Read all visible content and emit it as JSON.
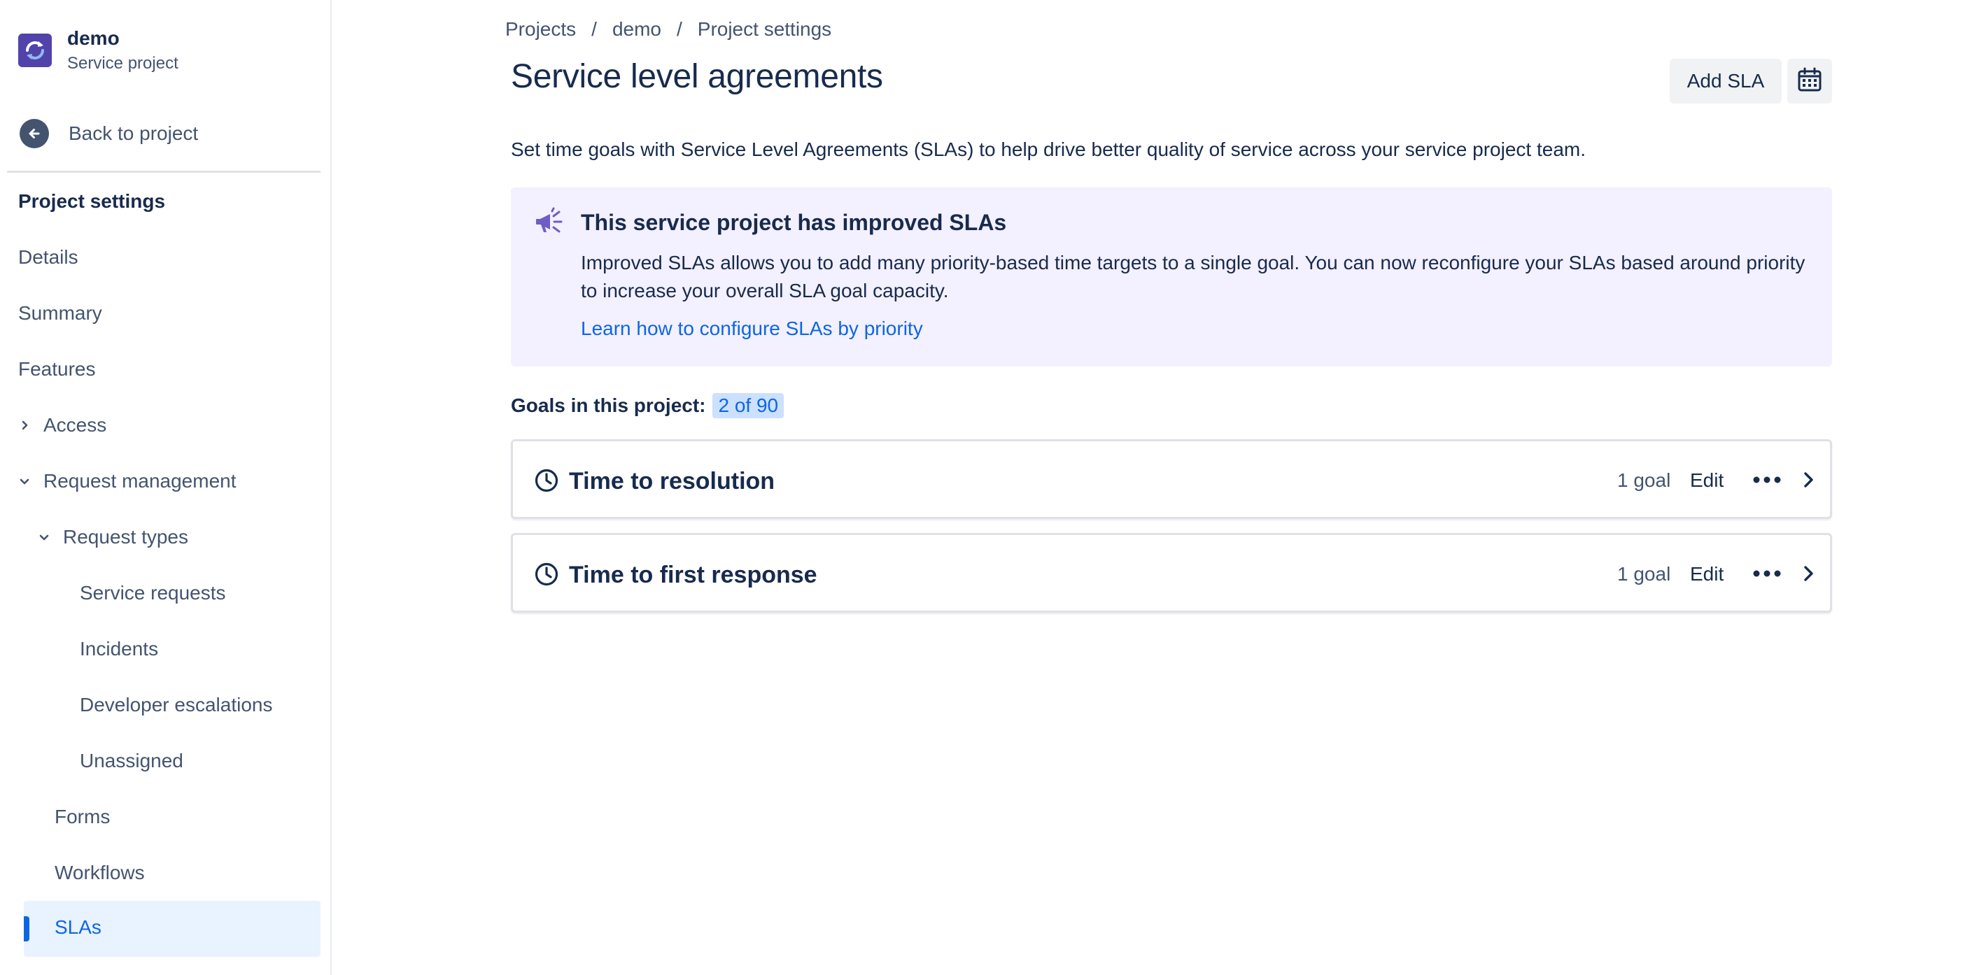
{
  "project": {
    "name": "demo",
    "type": "Service project"
  },
  "sidebar": {
    "back_label": "Back to project",
    "heading": "Project settings",
    "items": [
      {
        "label": "Details"
      },
      {
        "label": "Summary"
      },
      {
        "label": "Features"
      },
      {
        "label": "Access",
        "expandable": true,
        "expanded": false
      },
      {
        "label": "Request management",
        "expandable": true,
        "expanded": true
      },
      {
        "label": "Request types",
        "expandable": true,
        "expanded": true
      },
      {
        "label": "Service requests"
      },
      {
        "label": "Incidents"
      },
      {
        "label": "Developer escalations"
      },
      {
        "label": "Unassigned"
      },
      {
        "label": "Forms"
      },
      {
        "label": "Workflows"
      },
      {
        "label": "SLAs",
        "active": true
      }
    ]
  },
  "breadcrumb": [
    "Projects",
    "demo",
    "Project settings"
  ],
  "breadcrumb_separator": "/",
  "page": {
    "title": "Service level agreements",
    "add_button": "Add SLA",
    "calendar_icon": "calendar-icon",
    "intro": "Set time goals with Service Level Agreements (SLAs) to help drive better quality of service across your service project team."
  },
  "banner": {
    "icon": "megaphone-icon",
    "title": "This service project has improved SLAs",
    "body": "Improved SLAs allows you to add many priority-based time targets to a single goal. You can now reconfigure your SLAs based around priority to increase your overall SLA goal capacity.",
    "link": "Learn how to configure SLAs by priority"
  },
  "goals": {
    "label": "Goals in this project:",
    "count": "2 of 90"
  },
  "slas": [
    {
      "name": "Time to resolution",
      "goal_count": "1 goal",
      "edit_label": "Edit"
    },
    {
      "name": "Time to first response",
      "goal_count": "1 goal",
      "edit_label": "Edit"
    }
  ],
  "colors": {
    "primary_text": "#172b4d",
    "subtle_text": "#44546f",
    "link": "#0c66e4",
    "banner_bg": "#f3f0ff",
    "active_nav_bg": "#e9f2ff",
    "badge_bg": "#cce0ff",
    "project_avatar": "#5243aa"
  }
}
